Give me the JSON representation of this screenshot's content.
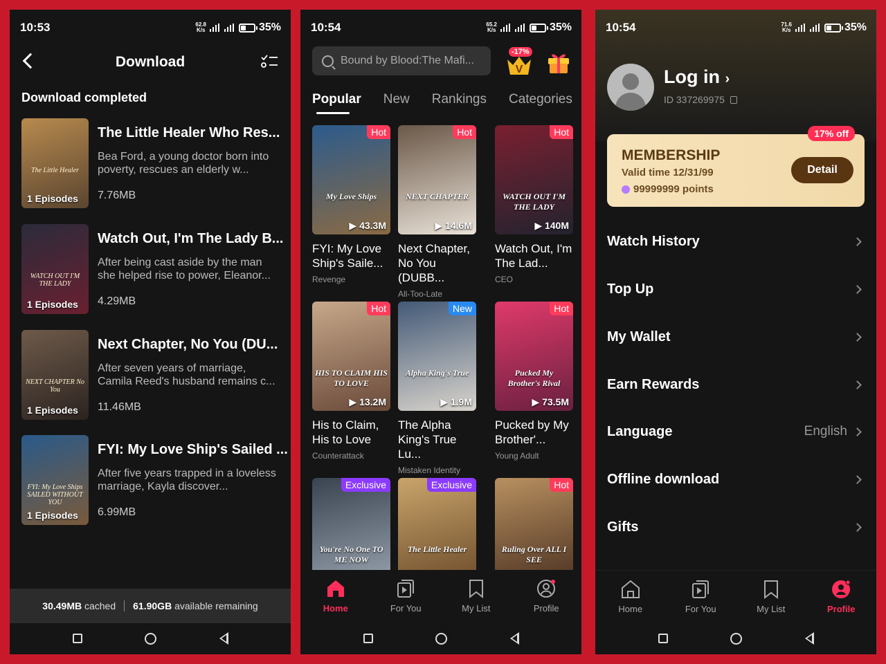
{
  "panel1": {
    "status": {
      "time": "10:53",
      "speed_top": "62.8",
      "speed_unit": "K/s",
      "battery": "35%"
    },
    "header_title": "Download",
    "section_title": "Download completed",
    "items": [
      {
        "title": "The Little Healer Who Res...",
        "desc": "Bea Ford, a young doctor born into poverty, rescues an elderly w...",
        "size": "7.76MB",
        "episodes": "1 Episodes",
        "colors": [
          "#b88a4e",
          "#5a4530"
        ],
        "poster_text": "The Little Healer"
      },
      {
        "title": "Watch Out, I'm The Lady B...",
        "desc": "After being cast aside by the man she helped rise to power, Eleanor...",
        "size": "4.29MB",
        "episodes": "1 Episodes",
        "colors": [
          "#2b2b3b",
          "#6a2030"
        ],
        "poster_text": "WATCH OUT I'M THE LADY"
      },
      {
        "title": "Next Chapter, No You (DU...",
        "desc": "After seven years of marriage, Camila Reed's husband remains c...",
        "size": "11.46MB",
        "episodes": "1 Episodes",
        "colors": [
          "#6e5a4a",
          "#2b2320"
        ],
        "poster_text": "NEXT CHAPTER No You"
      },
      {
        "title": "FYI: My Love Ship's Sailed ...",
        "desc": "After five years trapped in a loveless marriage, Kayla discover...",
        "size": "6.99MB",
        "episodes": "1 Episodes",
        "colors": [
          "#2a5a8a",
          "#7a5a3a"
        ],
        "poster_text": "FYI: My Love Ships SAILED WITHOUT YOU"
      }
    ],
    "storage_cached": "30.49MB",
    "storage_cached_label": "cached",
    "storage_avail": "61.90GB",
    "storage_avail_label": "available remaining"
  },
  "panel2": {
    "status": {
      "time": "10:54",
      "speed_top": "65.2",
      "speed_unit": "K/s",
      "battery": "35%"
    },
    "search_text": "Bound by Blood:The Mafi...",
    "vip_badge": "-17%",
    "vip_letter": "V",
    "tabs": [
      "Popular",
      "New",
      "Rankings",
      "Categories"
    ],
    "cards": [
      {
        "tag": "Hot",
        "tag_type": "hot",
        "views": "43.3M",
        "title": "FYI: My Love Ship's Saile...",
        "genre": "Revenge",
        "colors": [
          "#2c5b8c",
          "#8a6a44"
        ],
        "poster_text": "My Love Ships"
      },
      {
        "tag": "Hot",
        "tag_type": "hot",
        "views": "14.6M",
        "title": "Next Chapter, No You (DUBB...",
        "genre": "All-Too-Late",
        "colors": [
          "#6b5848",
          "#e9e2d8"
        ],
        "poster_text": "NEXT CHAPTER"
      },
      {
        "tag": "Hot",
        "tag_type": "hot",
        "views": "140M",
        "title": "Watch Out, I'm The Lad...",
        "genre": "CEO",
        "colors": [
          "#7a2030",
          "#23232f"
        ],
        "poster_text": "WATCH OUT I'M THE LADY"
      },
      {
        "tag": "Hot",
        "tag_type": "hot",
        "views": "13.2M",
        "title": "His to Claim, His to Love",
        "genre": "Counterattack",
        "colors": [
          "#c7a88a",
          "#6a4a3a"
        ],
        "poster_text": "HIS TO CLAIM HIS TO LOVE"
      },
      {
        "tag": "New",
        "tag_type": "new",
        "views": "1.9M",
        "title": "The Alpha King's True Lu...",
        "genre": "Mistaken Identity",
        "colors": [
          "#445a78",
          "#d9d4cc"
        ],
        "poster_text": "Alpha King's True"
      },
      {
        "tag": "Hot",
        "tag_type": "hot",
        "views": "73.5M",
        "title": "Pucked by My Brother'...",
        "genre": "Young Adult",
        "colors": [
          "#e03a6a",
          "#6a2040"
        ],
        "poster_text": "Pucked My Brother's Rival"
      },
      {
        "tag": "Exclusive",
        "tag_type": "ex",
        "views": "",
        "title": "",
        "genre": "",
        "colors": [
          "#3a4450",
          "#9aa4b0"
        ],
        "poster_text": "You're No One TO ME NOW"
      },
      {
        "tag": "Exclusive",
        "tag_type": "ex",
        "views": "",
        "title": "",
        "genre": "",
        "colors": [
          "#c9a46a",
          "#6a4a2a"
        ],
        "poster_text": "The Little Healer"
      },
      {
        "tag": "Hot",
        "tag_type": "hot",
        "views": "",
        "title": "",
        "genre": "",
        "colors": [
          "#b89060",
          "#4a3020"
        ],
        "poster_text": "Ruling Over ALL I SEE"
      }
    ],
    "tabbar": [
      "Home",
      "For You",
      "My List",
      "Profile"
    ]
  },
  "panel3": {
    "status": {
      "time": "10:54",
      "speed_top": "71.6",
      "speed_unit": "K/s",
      "battery": "35%"
    },
    "login": "Log in",
    "user_id": "ID 337269975",
    "membership": {
      "off": "17% off",
      "title": "MEMBERSHIP",
      "valid": "Valid time 12/31/99",
      "points": "99999999 points",
      "detail": "Detail"
    },
    "menu": [
      {
        "label": "Watch History",
        "value": ""
      },
      {
        "label": "Top Up",
        "value": ""
      },
      {
        "label": "My Wallet",
        "value": ""
      },
      {
        "label": "Earn Rewards",
        "value": ""
      },
      {
        "label": "Language",
        "value": "English"
      },
      {
        "label": "Offline download",
        "value": ""
      },
      {
        "label": "Gifts",
        "value": ""
      }
    ],
    "tabbar": [
      "Home",
      "For You",
      "My List",
      "Profile"
    ]
  },
  "colors": {
    "accent": "#ff2e5b",
    "frame": "#c8192b",
    "background": "#151515"
  }
}
